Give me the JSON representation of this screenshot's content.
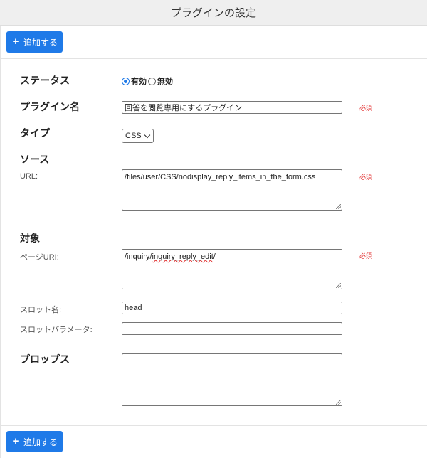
{
  "header": {
    "title": "プラグインの設定"
  },
  "toolbar": {
    "add_label": "追加する"
  },
  "footer": {
    "add_label": "追加する"
  },
  "form": {
    "status": {
      "label": "ステータス",
      "options": [
        {
          "label": "有効",
          "checked": true
        },
        {
          "label": "無効",
          "checked": false
        }
      ]
    },
    "plugin_name": {
      "label": "プラグイン名",
      "value": "回答を閲覧専用にするプラグイン",
      "required": "必須"
    },
    "type": {
      "label": "タイプ",
      "selected": "CSS"
    },
    "source": {
      "label": "ソース",
      "url_label": "URL:",
      "url_value": "/files/user/CSS/nodisplay_reply_items_in_the_form.css",
      "required": "必須"
    },
    "target": {
      "label": "対象",
      "page_uri_label": "ページURI:",
      "page_uri_prefix": "/inquiry/",
      "page_uri_misspelled": "inquiry_reply_edit",
      "page_uri_suffix": "/",
      "required": "必須",
      "slot_name_label": "スロット名:",
      "slot_name_value": "head",
      "slot_param_label": "スロットパラメータ:",
      "slot_param_value": ""
    },
    "props": {
      "label": "プロップス",
      "value": ""
    }
  },
  "icons": {
    "add": "plus-icon",
    "dropdown": "chevron-down-icon",
    "resize": "resize-grip-icon"
  },
  "colors": {
    "primary": "#1f7ae8",
    "required": "#e02020"
  }
}
